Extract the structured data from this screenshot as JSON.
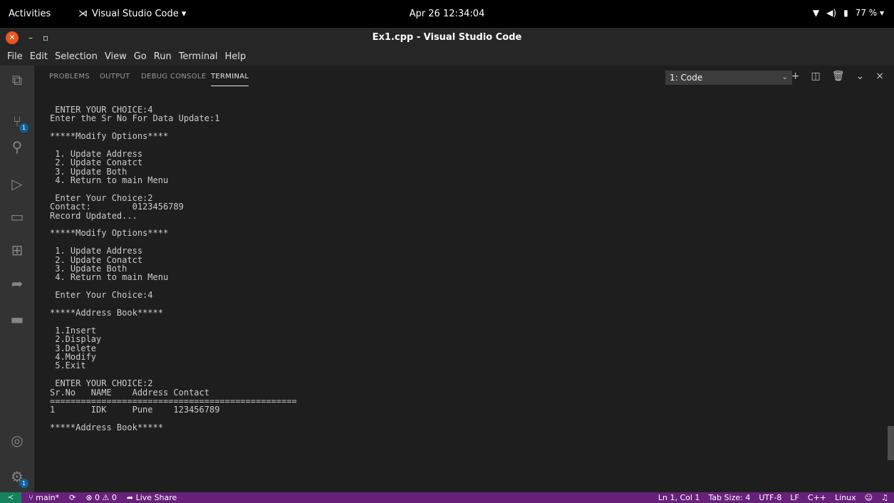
{
  "topbar": {
    "activities": "Activities",
    "app_name": "Visual Studio Code ▾",
    "clock": "Apr 26  12:34:04",
    "battery": "77 % ▾"
  },
  "titlebar": {
    "title": "Ex1.cpp - Visual Studio Code",
    "close_glyph": "✕",
    "minimize_glyph": "–",
    "restore_glyph": "▫"
  },
  "menu": [
    "File",
    "Edit",
    "Selection",
    "View",
    "Go",
    "Run",
    "Terminal",
    "Help"
  ],
  "activity_badges": {
    "source_control": "1",
    "manage": "1"
  },
  "panel": {
    "tabs": [
      "PROBLEMS",
      "OUTPUT",
      "DEBUG CONSOLE",
      "TERMINAL"
    ],
    "active_tab": "TERMINAL",
    "terminal_selector": "1: Code"
  },
  "terminal": {
    "lines": [
      " ENTER YOUR CHOICE:4",
      "Enter the Sr No For Data Update:1",
      "",
      "*****Modify Options****",
      "",
      " 1. Update Address",
      " 2. Update Conatct",
      " 3. Update Both",
      " 4. Return to main Menu",
      "",
      " Enter Your Choice:2",
      "Contact:        0123456789",
      "Record Updated...",
      "",
      "*****Modify Options****",
      "",
      " 1. Update Address",
      " 2. Update Conatct",
      " 3. Update Both",
      " 4. Return to main Menu",
      "",
      " Enter Your Choice:4",
      "",
      "*****Address Book*****",
      "",
      " 1.Insert",
      " 2.Display",
      " 3.Delete",
      " 4.Modify",
      " 5.Exit",
      "",
      " ENTER YOUR CHOICE:2",
      "Sr.No   NAME    Address Contact",
      "================================================",
      "1       IDK     Pune    123456789",
      "",
      "*****Address Book*****"
    ]
  },
  "statusbar": {
    "branch": "main*",
    "sync": "⟳",
    "problems": "⊗ 0 ⚠ 0",
    "live_share": "Live Share",
    "position": "Ln 1, Col 1",
    "tab_size": "Tab Size: 4",
    "encoding": "UTF-8",
    "eol": "LF",
    "language": "C++",
    "os": "Linux"
  },
  "colors": {
    "statusbar_bg": "#68217a",
    "remote_bg": "#16825d",
    "activitybar_bg": "#333333",
    "terminal_bg": "#1e1e1e",
    "close_button": "#e95420"
  }
}
